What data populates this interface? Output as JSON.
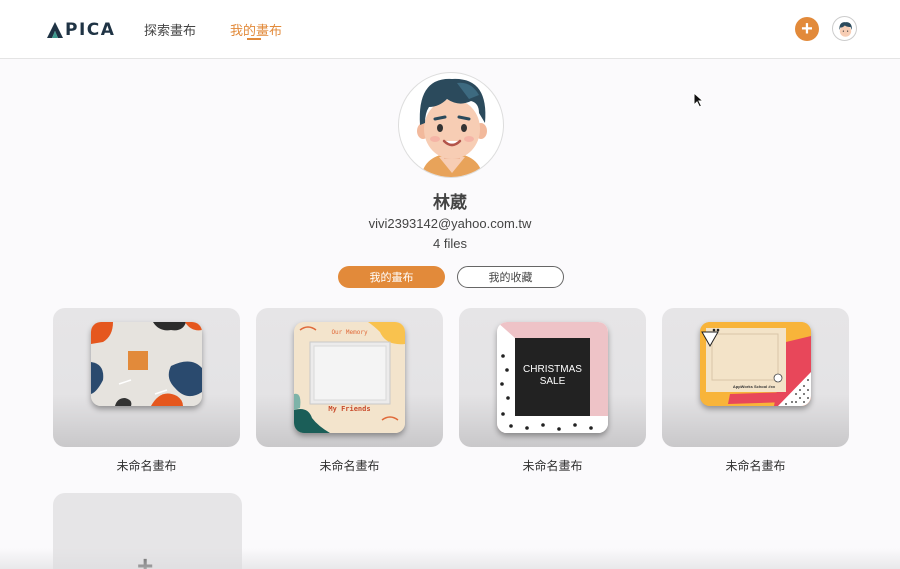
{
  "header": {
    "logo_text": "PICA",
    "nav": [
      {
        "label": "探索畫布"
      },
      {
        "label": "我的畫布"
      }
    ],
    "add_label": "+"
  },
  "profile": {
    "name": "林葳",
    "email": "vivi2393142@yahoo.com.tw",
    "files": "4 files"
  },
  "tabs": [
    {
      "label": "我的畫布",
      "active": true
    },
    {
      "label": "我的收藏",
      "active": false
    }
  ],
  "cards": [
    {
      "title": "未命名畫布"
    },
    {
      "title": "未命名畫布",
      "thumb_text": "Our Memory",
      "thumb_caption": "My Friends"
    },
    {
      "title": "未命名畫布",
      "thumb_line1": "CHRISTMAS",
      "thumb_line2": "SALE"
    },
    {
      "title": "未命名畫布",
      "thumb_caption": "AppWorks School #xx"
    }
  ],
  "new_card": {
    "label": "+"
  },
  "colors": {
    "accent": "#e28a3a",
    "logo": "#1f3344"
  }
}
